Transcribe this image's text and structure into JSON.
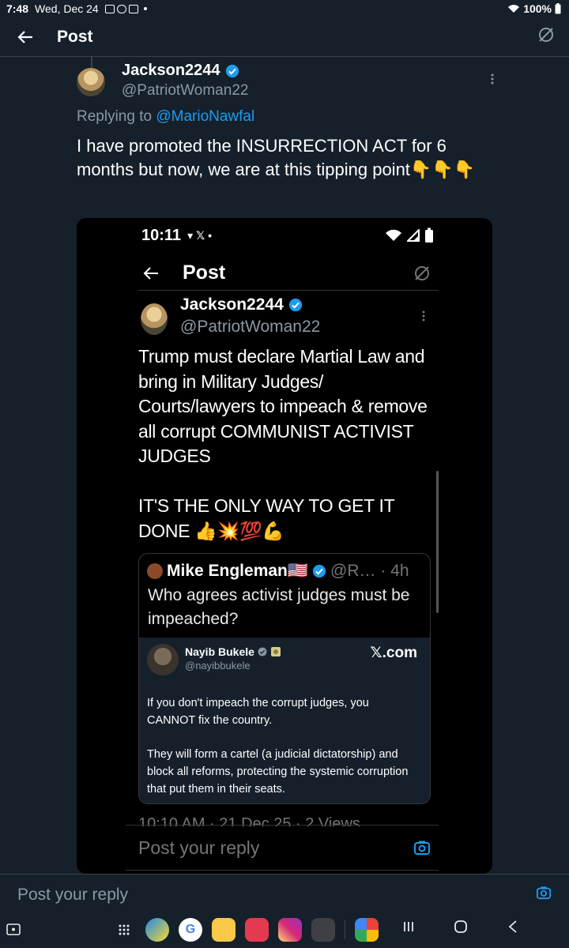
{
  "status": {
    "time": "7:48",
    "date": "Wed, Dec 24",
    "battery": "100%"
  },
  "header": {
    "title": "Post"
  },
  "tweet": {
    "name": "Jackson2244",
    "handle": "@PatriotWoman22",
    "replying_prefix": "Replying to",
    "replying_handle": "@MarioNawfal",
    "text": "I have promoted the INSURRECTION ACT for 6 months but now, we are at this tipping point👇👇👇"
  },
  "screenshot": {
    "status_time": "10:11",
    "status_icons": "▾ 𝕏 •",
    "header_title": "Post",
    "name": "Jackson2244",
    "handle": "@PatriotWoman22",
    "body": "Trump must declare Martial Law and bring in Military Judges/ Courts/lawyers to impeach & remove all corrupt COMMUNIST ACTIVIST JUDGES\n\nIT'S THE ONLY WAY TO GET IT DONE 👍💥💯💪",
    "quote": {
      "name": "Mike Engleman🇺🇸",
      "extra": "@R… · 4h",
      "text": "Who agrees activist judges must be impeached?",
      "card": {
        "name": "Nayib Bukele",
        "handle": "@nayibbukele",
        "brand": "𝕏.com",
        "p1": "If you don't impeach the corrupt judges, you CANNOT fix the country.",
        "p2": "They will form a cartel (a judicial dictatorship) and block all reforms, protecting the systemic corruption that put them in their seats."
      }
    },
    "meta": "10:10 AM · 21 Dec 25 · 2 Views",
    "reply_placeholder": "Post your reply"
  },
  "reply_bar": {
    "placeholder": "Post your reply"
  },
  "colors": {
    "bg": "#15202b",
    "accent": "#1d9bf0",
    "muted": "#8b98a5"
  },
  "nav": {
    "apps": [
      "app-drawer",
      "photo-app",
      "google",
      "files",
      "camera-app",
      "instagram",
      "app-folder",
      "google-photos"
    ]
  }
}
